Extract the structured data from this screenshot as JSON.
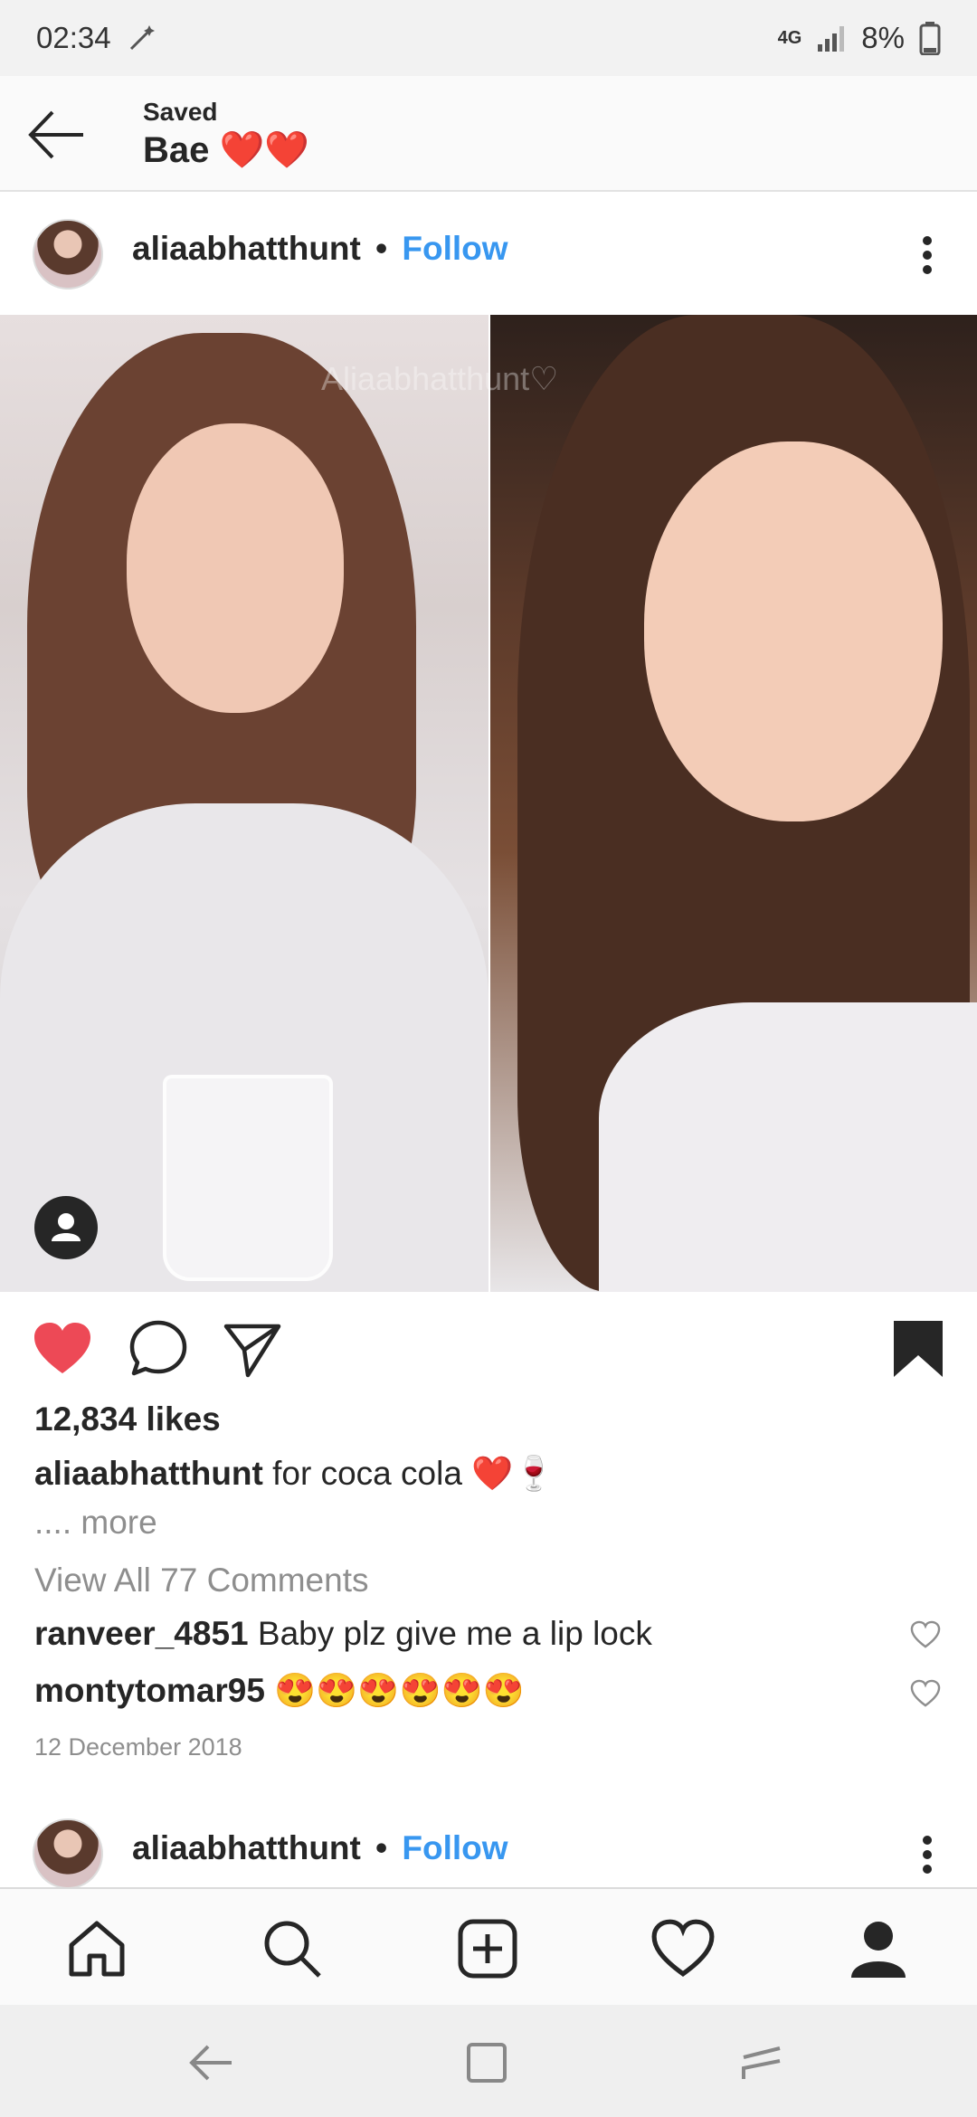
{
  "status_bar": {
    "time": "02:34",
    "network": "4G",
    "battery": "8%",
    "icons": [
      "magic-wand-icon",
      "signal-icon",
      "battery-icon"
    ]
  },
  "app_bar": {
    "subtitle": "Saved",
    "title": "Bae ❤️❤️"
  },
  "post": {
    "username": "aliaabhatthunt",
    "separator": "•",
    "follow_label": "Follow",
    "watermark": "Aliaabhatthunt♡",
    "likes": "12,834 likes",
    "caption_user": "aliaabhatthunt",
    "caption_text": "for coca cola ❤️🍷",
    "more_label": ".... more",
    "view_all_comments": "View All 77 Comments",
    "comments": [
      {
        "user": "ranveer_4851",
        "text": "Baby plz give me a lip lock"
      },
      {
        "user": "montytomar95",
        "text": "😍😍😍😍😍😍"
      }
    ],
    "date": "12 December 2018",
    "liked": true,
    "saved": true
  },
  "next_post": {
    "username": "aliaabhatthunt",
    "separator": "•",
    "follow_label": "Follow"
  },
  "bottom_nav": [
    "home",
    "search",
    "new-post",
    "activity",
    "profile"
  ],
  "colors": {
    "like_red": "#ed4956",
    "follow_blue": "#3897f0",
    "text_dark": "#262626",
    "text_muted": "#8e8e8e"
  }
}
